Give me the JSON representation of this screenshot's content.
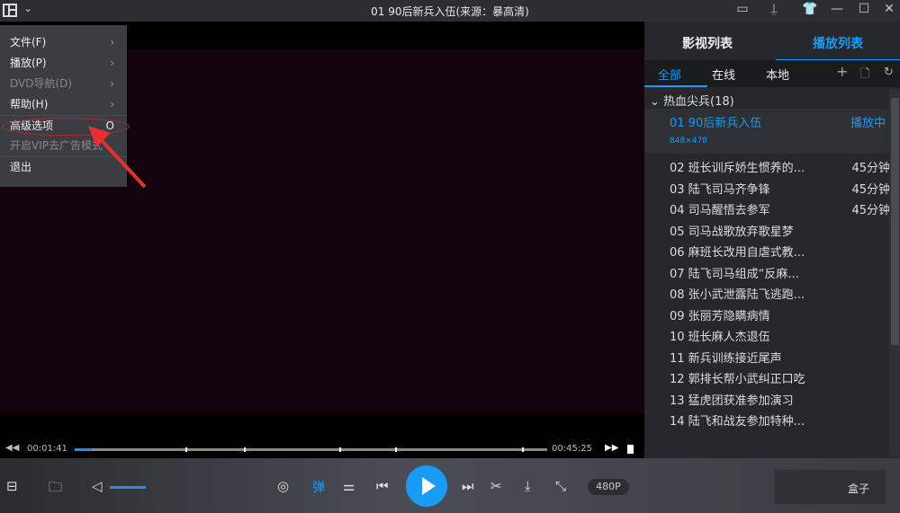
{
  "window": {
    "title": "01 90后新兵入伍(来源：暴高清)"
  },
  "menu": {
    "items": [
      {
        "label": "文件(F)",
        "submenu": true,
        "disabled": false
      },
      {
        "label": "播放(P)",
        "submenu": true,
        "disabled": false
      },
      {
        "label": "DVD导航(D)",
        "submenu": true,
        "disabled": true
      },
      {
        "label": "帮助(H)",
        "submenu": true,
        "disabled": false
      },
      {
        "label": "高级选项",
        "shortcut": "O",
        "disabled": false
      },
      {
        "label": "开启VIP去广告模式",
        "disabled": true
      },
      {
        "label": "退出",
        "disabled": false
      }
    ]
  },
  "player": {
    "elapsed": "00:01:41",
    "total": "00:45:25",
    "progress": 0.037,
    "quality": "480P",
    "danmaku": "弹",
    "volume": 0.6,
    "extra": "盒子"
  },
  "panel": {
    "tabs": [
      "影视列表",
      "播放列表"
    ],
    "active_tab": 1,
    "subtabs": [
      "全部",
      "在线",
      "本地"
    ],
    "group": "热血尖兵(18)",
    "current": {
      "title": "01 90后新兵入伍",
      "status": "播放中",
      "resolution": "848×478"
    },
    "items": [
      {
        "title": "02 班长训斥娇生惯养的...",
        "duration": "45分钟"
      },
      {
        "title": "03 陆飞司马齐争锋",
        "duration": "45分钟"
      },
      {
        "title": "04 司马醒悟去参军",
        "duration": "45分钟"
      },
      {
        "title": "05 司马战歌放弃歌星梦"
      },
      {
        "title": "06 麻班长改用自虐式教..."
      },
      {
        "title": "07 陆飞司马组成“反麻..."
      },
      {
        "title": "08 张小武泄露陆飞逃跑..."
      },
      {
        "title": "09 张丽芳隐瞒病情"
      },
      {
        "title": "10 班长麻人杰退伍"
      },
      {
        "title": "11 新兵训练接近尾声"
      },
      {
        "title": "12 郭排长帮小武纠正口吃"
      },
      {
        "title": "13 猛虎团获准参加演习"
      },
      {
        "title": "14 陆飞和战友参加特种..."
      }
    ]
  },
  "colors": {
    "accent": "#1a9bf5",
    "highlight": "#c0282a"
  }
}
